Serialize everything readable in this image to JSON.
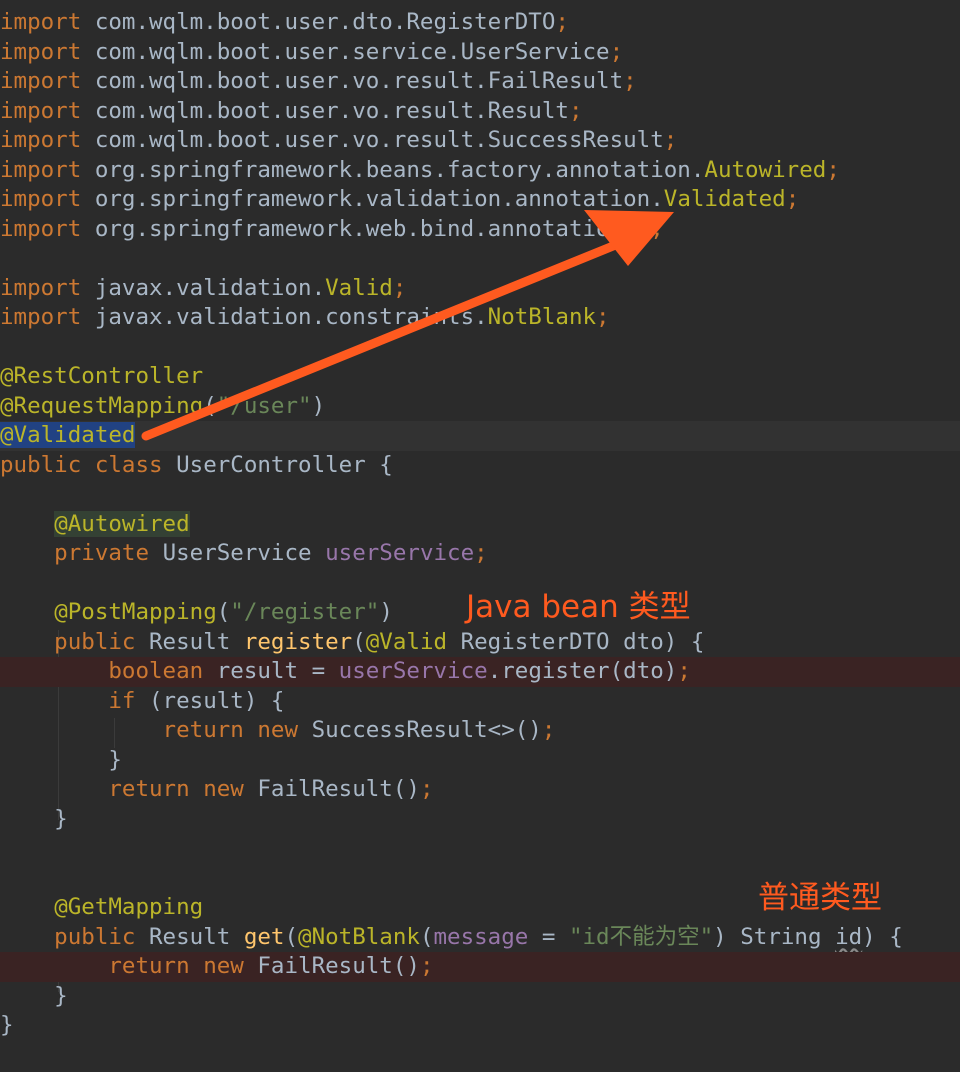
{
  "code": [
    {
      "cls": "",
      "tokens": [
        [
          "kw",
          "import "
        ],
        [
          "pl",
          "com.wqlm.boot.user.dto.RegisterDTO"
        ],
        [
          "kw",
          ";"
        ]
      ]
    },
    {
      "cls": "",
      "tokens": [
        [
          "kw",
          "import "
        ],
        [
          "pl",
          "com.wqlm.boot.user.service.UserService"
        ],
        [
          "kw",
          ";"
        ]
      ]
    },
    {
      "cls": "",
      "tokens": [
        [
          "kw",
          "import "
        ],
        [
          "pl",
          "com.wqlm.boot.user.vo.result.FailResult"
        ],
        [
          "kw",
          ";"
        ]
      ]
    },
    {
      "cls": "",
      "tokens": [
        [
          "kw",
          "import "
        ],
        [
          "pl",
          "com.wqlm.boot.user.vo.result.Result"
        ],
        [
          "kw",
          ";"
        ]
      ]
    },
    {
      "cls": "",
      "tokens": [
        [
          "kw",
          "import "
        ],
        [
          "pl",
          "com.wqlm.boot.user.vo.result.SuccessResult"
        ],
        [
          "kw",
          ";"
        ]
      ]
    },
    {
      "cls": "",
      "tokens": [
        [
          "kw",
          "import "
        ],
        [
          "pl",
          "org.springframework.beans.factory.annotation."
        ],
        [
          "ann",
          "Autowired"
        ],
        [
          "kw",
          ";"
        ]
      ]
    },
    {
      "cls": "",
      "tokens": [
        [
          "kw",
          "import "
        ],
        [
          "pl",
          "org.springframework.validation.annotation."
        ],
        [
          "ann",
          "Validated"
        ],
        [
          "kw",
          ";"
        ]
      ]
    },
    {
      "cls": "",
      "tokens": [
        [
          "kw",
          "import "
        ],
        [
          "pl",
          "org.springframework.web.bind.annotation.*"
        ],
        [
          "kw",
          ";"
        ]
      ]
    },
    {
      "cls": "",
      "tokens": []
    },
    {
      "cls": "",
      "tokens": [
        [
          "kw",
          "import "
        ],
        [
          "pl",
          "javax.validation."
        ],
        [
          "ann",
          "Valid"
        ],
        [
          "kw",
          ";"
        ]
      ]
    },
    {
      "cls": "",
      "tokens": [
        [
          "kw",
          "import "
        ],
        [
          "pl",
          "javax.validation.constraints."
        ],
        [
          "ann",
          "NotBlank"
        ],
        [
          "kw",
          ";"
        ]
      ]
    },
    {
      "cls": "",
      "tokens": []
    },
    {
      "cls": "",
      "tokens": [
        [
          "ann",
          "@RestController"
        ]
      ]
    },
    {
      "cls": "",
      "tokens": [
        [
          "ann",
          "@RequestMapping"
        ],
        [
          "pl",
          "("
        ],
        [
          "str",
          "\"/user\""
        ],
        [
          "pl",
          ")"
        ]
      ]
    },
    {
      "cls": "caret",
      "tokens": [
        [
          "ann selected",
          "@Validated"
        ]
      ]
    },
    {
      "cls": "",
      "tokens": [
        [
          "kw",
          "public class "
        ],
        [
          "pl",
          "UserController {"
        ]
      ]
    },
    {
      "cls": "",
      "tokens": []
    },
    {
      "cls": "",
      "tokens": [
        [
          "pl",
          "    "
        ],
        [
          "ann hl",
          "@Autowired"
        ]
      ]
    },
    {
      "cls": "",
      "tokens": [
        [
          "kw",
          "    private "
        ],
        [
          "pl",
          "UserService "
        ],
        [
          "fld",
          "userService"
        ],
        [
          "kw",
          ";"
        ]
      ]
    },
    {
      "cls": "",
      "tokens": []
    },
    {
      "cls": "",
      "tokens": [
        [
          "pl",
          "    "
        ],
        [
          "ann",
          "@PostMapping"
        ],
        [
          "pl",
          "("
        ],
        [
          "str",
          "\"/register\""
        ],
        [
          "pl",
          ")"
        ]
      ]
    },
    {
      "cls": "",
      "tokens": [
        [
          "kw",
          "    public "
        ],
        [
          "pl",
          "Result "
        ],
        [
          "fn",
          "register"
        ],
        [
          "pl",
          "("
        ],
        [
          "ann",
          "@Valid "
        ],
        [
          "pl",
          "RegisterDTO dto) {"
        ]
      ]
    },
    {
      "cls": "bp",
      "tokens": [
        [
          "kw",
          "        boolean "
        ],
        [
          "pl",
          "result = "
        ],
        [
          "fld",
          "userService"
        ],
        [
          "pl",
          ".register(dto)"
        ],
        [
          "kw",
          ";"
        ]
      ]
    },
    {
      "cls": "",
      "tokens": [
        [
          "kw",
          "        if "
        ],
        [
          "pl",
          "(result) {"
        ]
      ]
    },
    {
      "cls": "",
      "tokens": [
        [
          "kw",
          "            return new "
        ],
        [
          "pl",
          "SuccessResult<>()"
        ],
        [
          "kw",
          ";"
        ]
      ]
    },
    {
      "cls": "",
      "tokens": [
        [
          "pl",
          "        }"
        ]
      ]
    },
    {
      "cls": "",
      "tokens": [
        [
          "kw",
          "        return new "
        ],
        [
          "pl",
          "FailResult()"
        ],
        [
          "kw",
          ";"
        ]
      ]
    },
    {
      "cls": "",
      "tokens": [
        [
          "pl",
          "    }"
        ]
      ]
    },
    {
      "cls": "",
      "tokens": []
    },
    {
      "cls": "",
      "tokens": []
    },
    {
      "cls": "",
      "tokens": [
        [
          "pl",
          "    "
        ],
        [
          "ann",
          "@GetMapping"
        ]
      ]
    },
    {
      "cls": "",
      "tokens": [
        [
          "kw",
          "    public "
        ],
        [
          "pl",
          "Result "
        ],
        [
          "fn",
          "get"
        ],
        [
          "pl",
          "("
        ],
        [
          "ann",
          "@NotBlank"
        ],
        [
          "pl",
          "("
        ],
        [
          "fld",
          "message"
        ],
        [
          "pl",
          " = "
        ],
        [
          "str",
          "\"id不能为空\""
        ],
        [
          "pl",
          ") String "
        ],
        [
          "pl underline",
          "id"
        ],
        [
          "pl",
          ") {"
        ]
      ]
    },
    {
      "cls": "bp",
      "tokens": [
        [
          "kw",
          "        return new "
        ],
        [
          "pl",
          "FailResult()"
        ],
        [
          "kw",
          ";"
        ]
      ]
    },
    {
      "cls": "",
      "tokens": [
        [
          "pl",
          "    }"
        ]
      ]
    },
    {
      "cls": "",
      "tokens": [
        [
          "pl",
          "}"
        ]
      ]
    }
  ],
  "annotations": {
    "java_bean_label": "Java bean 类型",
    "plain_type_label": "普通类型"
  },
  "colors": {
    "background": "#2b2b2b",
    "keyword": "#cc7832",
    "annotation": "#bbb529",
    "string": "#6a8759",
    "field": "#9876aa",
    "method": "#ffc66d",
    "text": "#a9b7c6",
    "arrow": "#ff5a1f"
  }
}
